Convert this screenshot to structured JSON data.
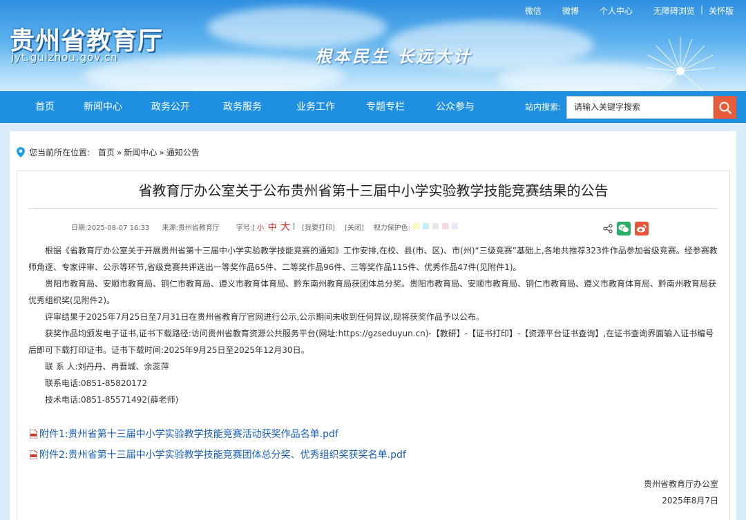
{
  "header": {
    "site_name": "贵州省教育厅",
    "site_url": "jyt.guizhou.gov.cn",
    "slogan": "根本民生 长远大计",
    "top_links": [
      "微信",
      "微博",
      "个人中心",
      "无障碍浏览",
      "关怀版"
    ],
    "top_link_separator": "|"
  },
  "nav": {
    "items": [
      "首页",
      "新闻中心",
      "政务公开",
      "政务服务",
      "业务工作",
      "专题专栏",
      "公众参与"
    ],
    "search_label": "站内搜索:",
    "search_placeholder": "请输入关键字搜索"
  },
  "breadcrumb": {
    "prefix": "您当前所在位置:",
    "items": [
      "首页",
      "新闻中心",
      "通知公告"
    ],
    "separator": "»"
  },
  "article": {
    "title": "省教育厅办公室关于公布贵州省第十三届中小学实验教学技能竞赛结果的公告",
    "meta": {
      "date": "日期:2025-08-07 16:33",
      "source": "来源:贵州省教育厅",
      "font_size_label": "字号:[",
      "font_small": "小",
      "font_mid": "中",
      "font_big": "大",
      "font_close": "]",
      "print": "[我要打印]",
      "close": "[关闭]",
      "eye_care_label": "视力保护色:",
      "eye_care_colors": [
        "#fafac0",
        "#c8ecf8",
        "#e6e6e6",
        "#f8d8e0",
        "#e8e8f8",
        "#ffffff"
      ]
    },
    "paragraphs": [
      "根据《省教育厅办公室关于开展贵州省第十三届中小学实验教学技能竞赛的通知》工作安排,在校、县(市、区)、市(州)“三级竞赛”基础上,各地共推荐323件作品参加省级竞赛。经参赛教师角逐、专家评审、公示等环节,省级竞赛共评选出一等奖作品65件、二等奖作品96件、三等奖作品115件、优秀作品47件(见附件1)。",
      "贵阳市教育局、安顺市教育局、铜仁市教育局、遵义市教育体育局、黔东南州教育局获团体总分奖。贵阳市教育局、安顺市教育局、铜仁市教育局、遵义市教育体育局、黔南州教育局获优秀组织奖(见附件2)。",
      "评审结果于2025年7月25日至7月31日在贵州省教育厅官网进行公示,公示期间未收到任何异议,现将获奖作品予以公布。",
      "获奖作品均颁发电子证书,证书下载路径:访问贵州省教育资源公共服务平台(网址:https://gzseduyun.cn)-【教研】-【证书打印】-【资源平台证书查询】,在证书查询界面输入证书编号后即可下载打印证书。证书下载时间:2025年9月25日至2025年12月30日。",
      "联 系 人:刘丹丹、冉晋城、余蕊萍",
      "联系电话:0851-85820172",
      "技术电话:0851-85571492(薛老师)"
    ],
    "attachments": [
      "附件1:贵州省第十三届中小学实验教学技能竞赛活动获奖作品名单.pdf",
      "附件2:贵州省第十三届中小学实验教学技能竞赛团体总分奖、优秀组织奖获奖名单.pdf"
    ],
    "signature": "贵州省教育厅办公室",
    "sign_date": "2025年8月7日"
  },
  "colors": {
    "nav_bg": "#1e8fe1",
    "search_button": "#e75d3c",
    "link": "#1a5fb4",
    "font_highlight": "#e2231a",
    "wechat": "#2aae67",
    "weibo": "#e6553a"
  },
  "icons": [
    "location-pin-icon",
    "search-icon",
    "share-icon",
    "wechat-icon",
    "weibo-icon",
    "pdf-icon"
  ]
}
